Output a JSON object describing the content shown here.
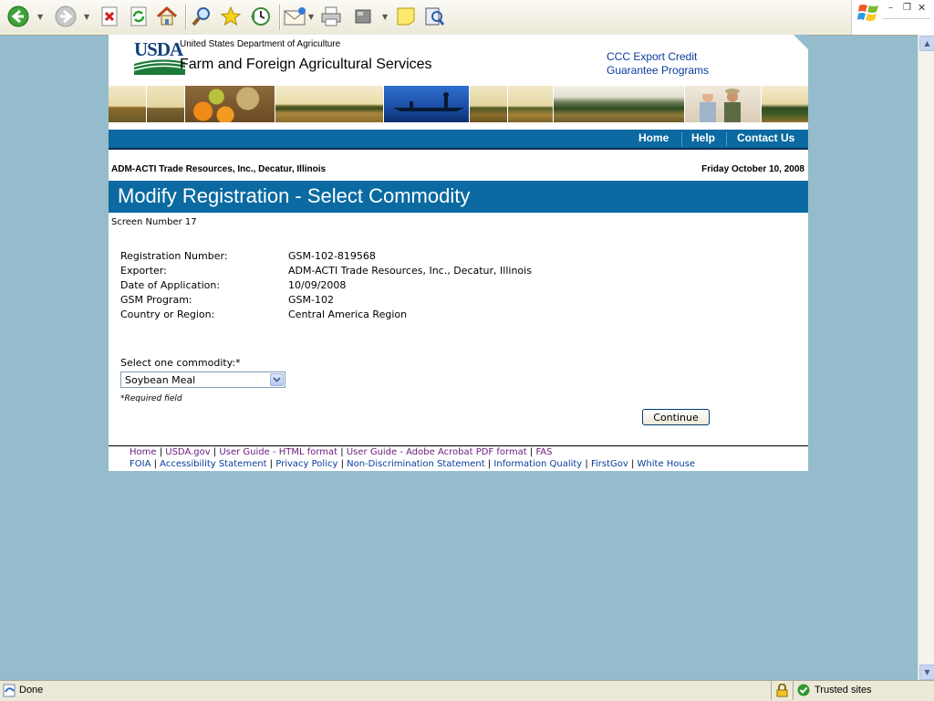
{
  "browser": {
    "status_text": "Done",
    "zone_text": "Trusted sites"
  },
  "header": {
    "logo_text": "USDA",
    "department": "United States Department of Agriculture",
    "agency": "Farm and Foreign Agricultural Services",
    "program_link_line1": "CCC Export Credit",
    "program_link_line2": "Guarantee Programs"
  },
  "nav": {
    "home": "Home",
    "help": "Help",
    "contact": "Contact Us"
  },
  "context": {
    "company": "ADM-ACTI Trade Resources, Inc., Decatur, Illinois",
    "date": "Friday October 10, 2008"
  },
  "page": {
    "title": "Modify Registration - Select Commodity",
    "screen_number": "Screen Number 17"
  },
  "registration": {
    "fields": [
      {
        "label": "Registration Number:",
        "value": "GSM-102-819568"
      },
      {
        "label": "Exporter:",
        "value": "ADM-ACTI Trade Resources, Inc., Decatur, Illinois"
      },
      {
        "label": "Date of Application:",
        "value": "10/09/2008"
      },
      {
        "label": "GSM Program:",
        "value": "GSM-102"
      },
      {
        "label": "Country or Region:",
        "value": "Central America Region"
      }
    ]
  },
  "form": {
    "select_label": "Select one commodity:*",
    "selected_commodity": "Soybean Meal",
    "required_note": "*Required field",
    "continue_label": "Continue"
  },
  "footer": {
    "line1": [
      "Home",
      "USDA.gov",
      "User Guide - HTML format",
      "User Guide - Adobe Acrobat PDF format",
      "FAS"
    ],
    "line2": [
      "FOIA",
      "Accessibility Statement",
      "Privacy Policy",
      "Non-Discrimination Statement",
      "Information Quality",
      "FirstGov",
      "White House"
    ]
  }
}
